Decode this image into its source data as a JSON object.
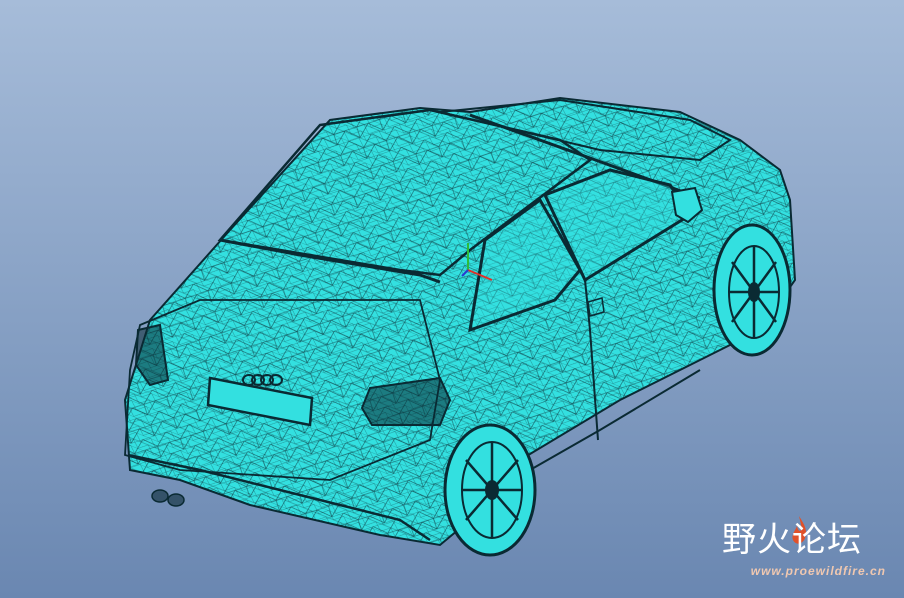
{
  "viewport": {
    "background_top": "#a6bcd9",
    "background_bottom": "#6a87b1",
    "model_fill": "#33e0e0",
    "mesh_color": "#0a2a33"
  },
  "model": {
    "badge_icon": "four-rings-logo"
  },
  "watermark": {
    "title": "野火论坛",
    "url": "www.proewildfire.cn",
    "title_color": "#ffffff",
    "accent_color": "#e0512a",
    "url_color": "#f0c8b0"
  }
}
